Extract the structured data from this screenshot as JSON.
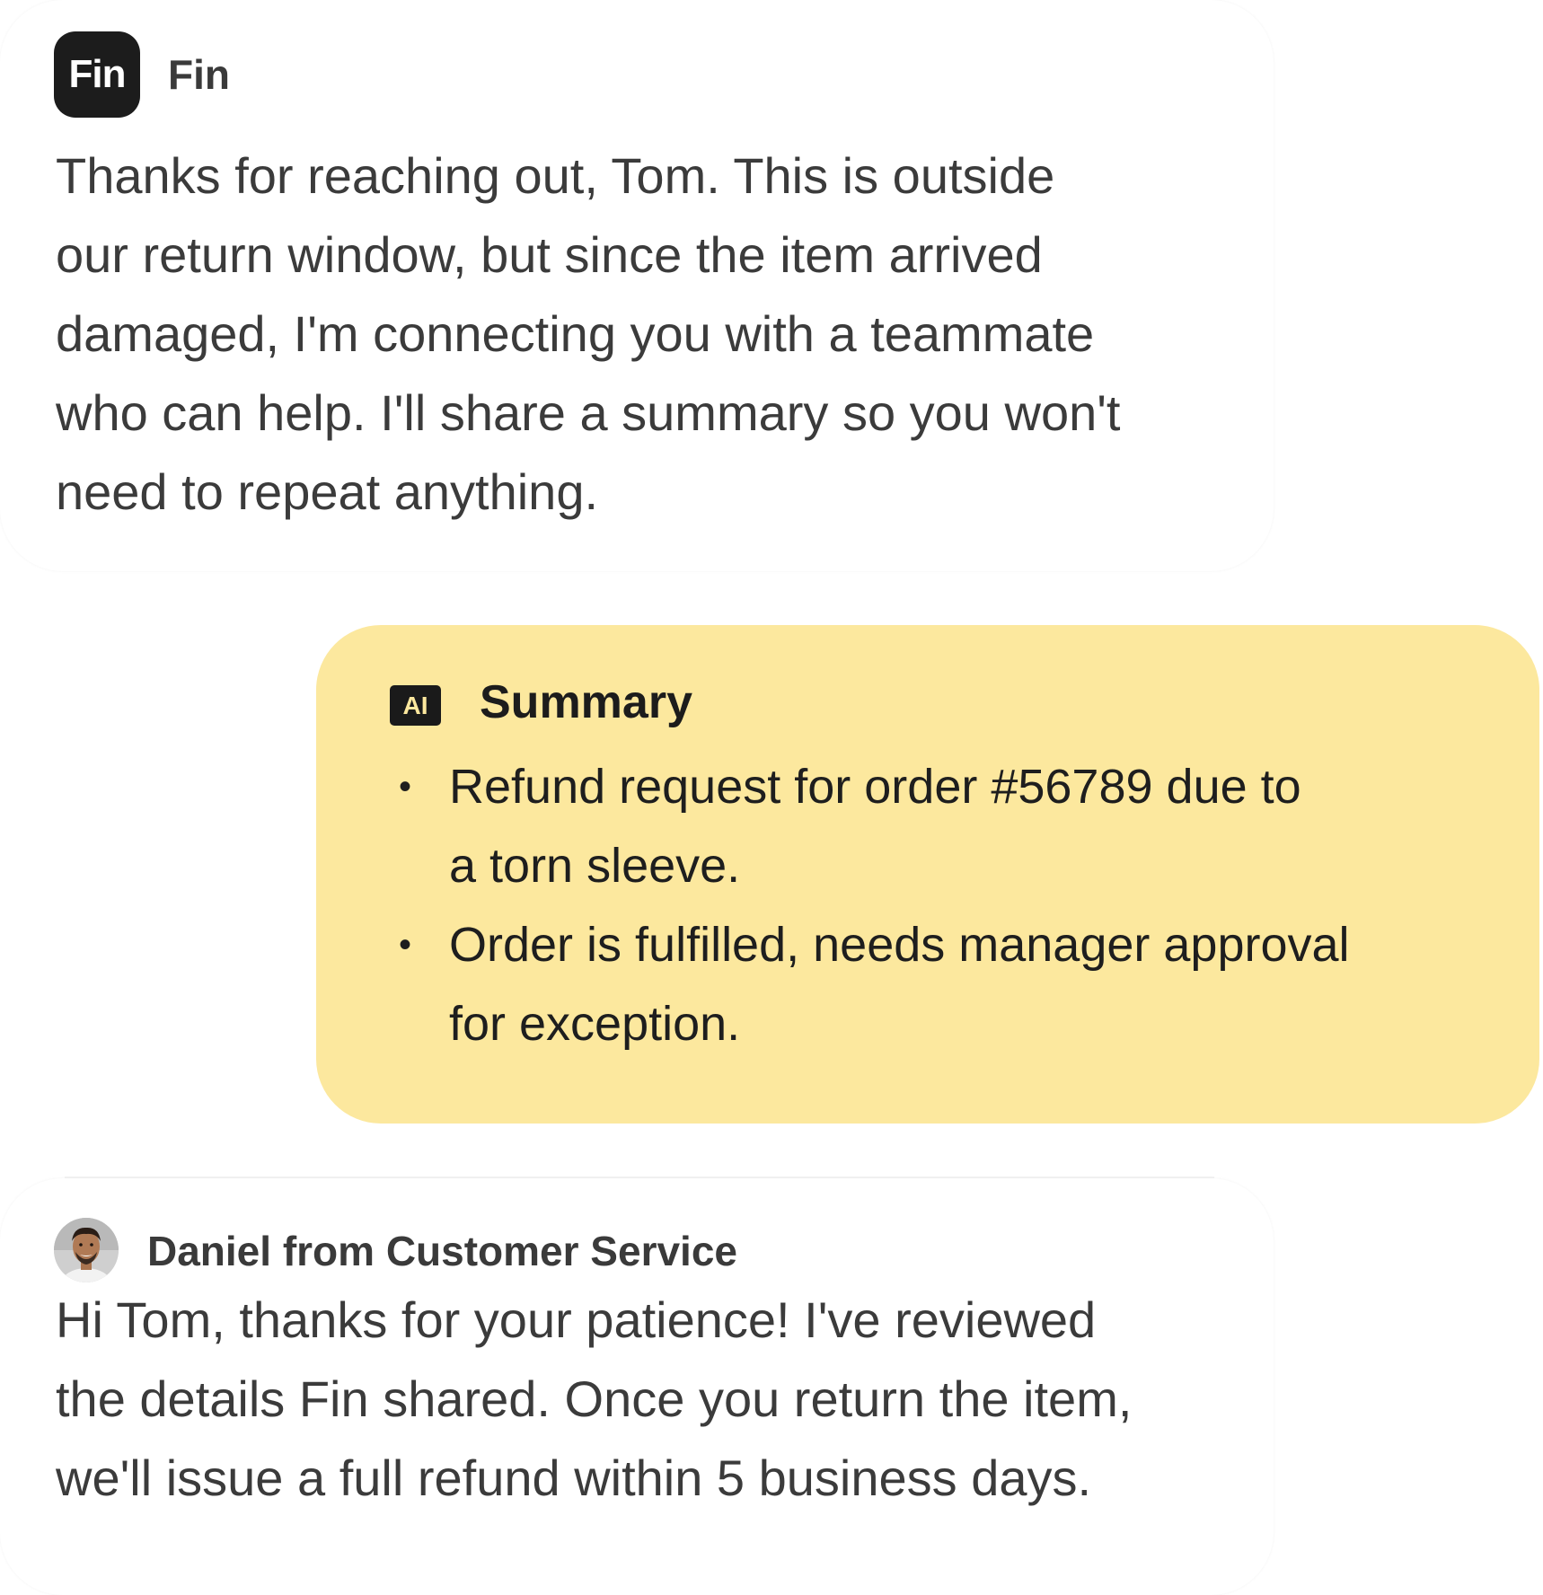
{
  "fin_message": {
    "logo_text": "Fin",
    "sender": "Fin",
    "lines": [
      "Thanks for reaching out, Tom. This is outside",
      "our return window, but since the item arrived",
      "damaged, I'm connecting you with a teammate",
      "who can help. I'll share a summary so you won't",
      "need to repeat anything."
    ]
  },
  "summary": {
    "badge": "AI",
    "title": "Summary",
    "items": [
      {
        "lines": [
          "Refund request for order #56789 due to",
          "a torn sleeve."
        ]
      },
      {
        "lines": [
          "Order is fulfilled, needs manager approval",
          "for exception."
        ]
      }
    ],
    "bullet": "•"
  },
  "agent_message": {
    "sender": "Daniel from Customer Service",
    "lines": [
      "Hi Tom, thanks for your patience! I've reviewed",
      "the details Fin shared. Once you return the item,",
      "we'll issue a full refund within 5 business days."
    ]
  },
  "colors": {
    "summary_background": "#fce89e",
    "logo_background": "#1c1c1c",
    "text": "#3b3b3b"
  }
}
